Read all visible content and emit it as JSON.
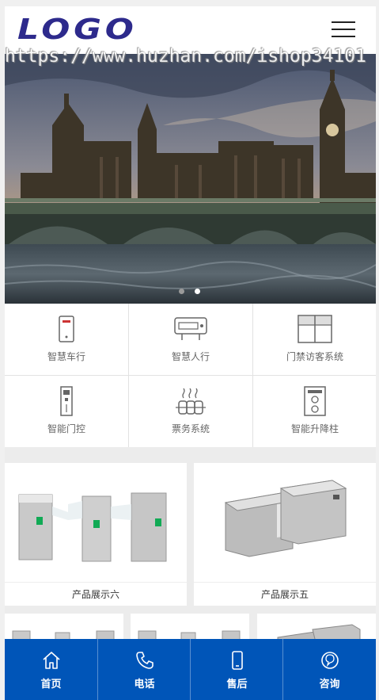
{
  "header": {
    "logo_text": "LOGO"
  },
  "watermark": {
    "text": "https://www.huzhan.com/ishop34101"
  },
  "banner": {
    "slide_count": 2,
    "active_index": 1
  },
  "features": [
    {
      "label": "智慧车行",
      "icon": "smart-parking-icon"
    },
    {
      "label": "智慧人行",
      "icon": "pedestrian-gate-icon"
    },
    {
      "label": "门禁访客系统",
      "icon": "access-visitor-icon"
    },
    {
      "label": "智能门控",
      "icon": "door-control-icon"
    },
    {
      "label": "票务系统",
      "icon": "ticket-system-icon"
    },
    {
      "label": "智能升降柱",
      "icon": "lifting-bollard-icon"
    }
  ],
  "products": [
    {
      "caption": "产品展示六"
    },
    {
      "caption": "产品展示五"
    }
  ],
  "bottom_nav": [
    {
      "label": "首页",
      "icon": "home-icon"
    },
    {
      "label": "电话",
      "icon": "phone-icon"
    },
    {
      "label": "售后",
      "icon": "mobile-icon"
    },
    {
      "label": "咨询",
      "icon": "chat-icon"
    }
  ],
  "colors": {
    "logo": "#2d2a8c",
    "nav_bg": "#0055b8",
    "icon_gray": "#666666"
  }
}
